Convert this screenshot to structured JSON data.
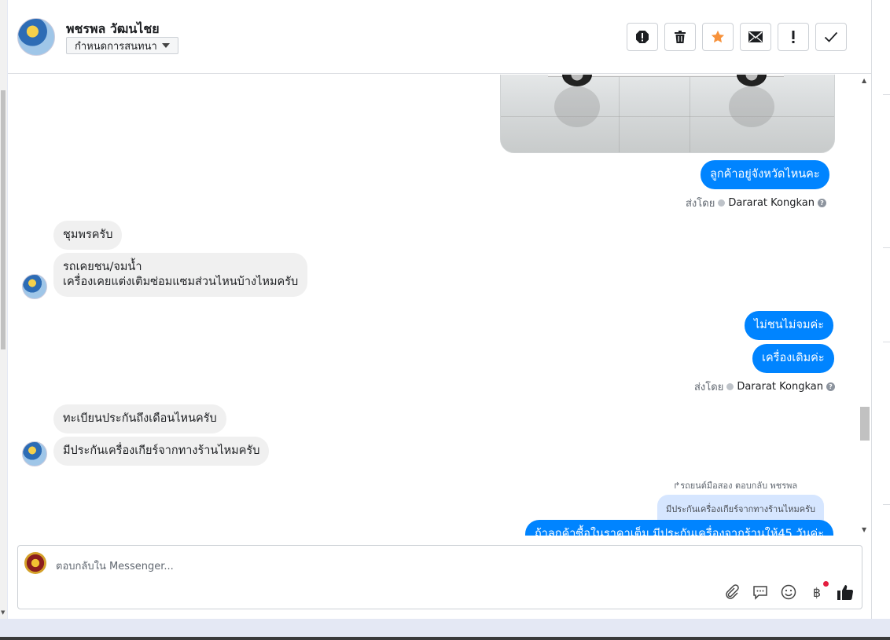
{
  "header": {
    "contact_name": "พชรพล วัฒนไชย",
    "assign_label": "กำหนดการสนทนา",
    "actions": [
      "spam-icon",
      "trash-icon",
      "star-icon",
      "envelope-icon",
      "exclamation-icon",
      "check-icon"
    ]
  },
  "messages": {
    "out1": "ลูกค้าอยู่จังหวัดไหนคะ",
    "sent_by_label": "ส่งโดย",
    "sender": "Dararat Kongkan",
    "in1": "ชุมพรครับ",
    "in2_line1": "รถเคยชน/จมน้ำ",
    "in2_line2": "เครื่องเคยแต่งเติมซ่อมแซมส่วนไหนบ้างไหมครับ",
    "out2": "ไม่ชนไม่จมค่ะ",
    "out3": "เครื่องเดิมค่ะ",
    "in3": "ทะเบียนประกันถึงเดือนไหนครับ",
    "in4": "มีประกันเครื่องเกียร์จากทางร้านไหมครับ",
    "reply_label": "รถยนต์มือสอง ตอบกลับ พชรพล",
    "quoted": "มีประกันเครื่องเกียร์จากทางร้านไหมครับ",
    "out4_partial": "ถ้าลูกค้าซื้อในราคาเต็ม มีประกันเครื่องจากร้านให้45 วันค่ะ"
  },
  "composer": {
    "placeholder": "ตอบกลับใน Messenger...",
    "tools": [
      "paperclip-icon",
      "saved-reply-icon",
      "emoji-icon",
      "baht-payment-icon",
      "thumbs-up-icon"
    ],
    "baht_symbol": "฿"
  }
}
